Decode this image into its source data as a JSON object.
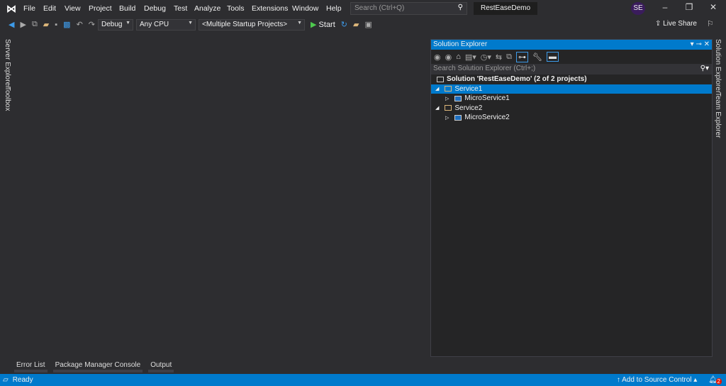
{
  "menu": [
    "File",
    "Edit",
    "View",
    "Project",
    "Build",
    "Debug",
    "Test",
    "Analyze",
    "Tools",
    "Extensions",
    "Window",
    "Help"
  ],
  "search_placeholder": "Search (Ctrl+Q)",
  "solution_name": "RestEaseDemo",
  "avatar": "SE",
  "toolbar": {
    "config": "Debug",
    "platform": "Any CPU",
    "startup": "<Multiple Startup Projects>",
    "start": "Start",
    "live_share": "Live Share"
  },
  "left_tabs": [
    "Server Explorer",
    "Toolbox"
  ],
  "right_tabs": [
    "Solution Explorer",
    "Team Explorer"
  ],
  "solution_explorer": {
    "title": "Solution Explorer",
    "search_placeholder": "Search Solution Explorer (Ctrl+;)",
    "items": [
      {
        "label": "Solution 'RestEaseDemo' (2 of 2 projects)"
      },
      {
        "label": "Service1"
      },
      {
        "label": "MicroService1"
      },
      {
        "label": "Service2"
      },
      {
        "label": "MicroService2"
      }
    ]
  },
  "bottom_tabs": [
    "Error List",
    "Package Manager Console",
    "Output"
  ],
  "status": {
    "text": "Ready",
    "source_control": "Add to Source Control",
    "notifications": "2"
  },
  "colors": {
    "accent": "#007acc",
    "bg": "#2d2d30"
  }
}
